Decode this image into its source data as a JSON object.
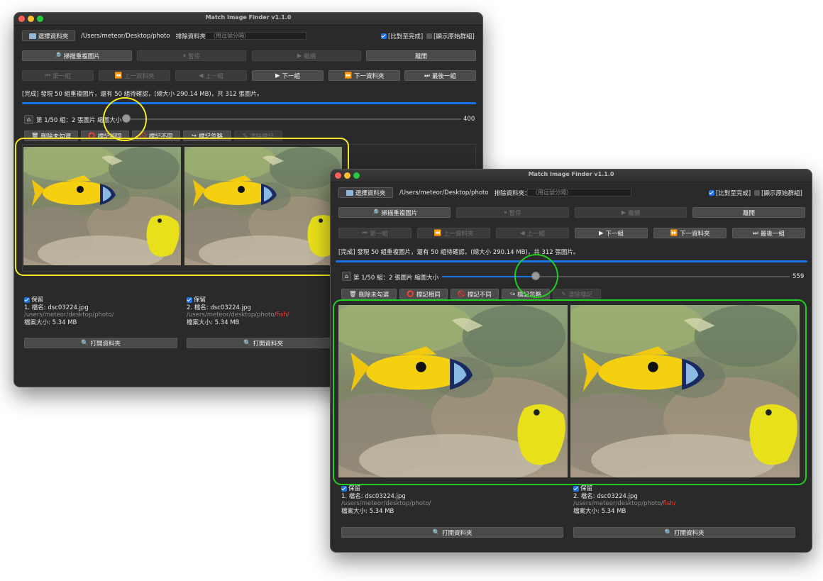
{
  "app": {
    "title": "Match Image Finder v1.1.0"
  },
  "toolbar": {
    "choose_folder": "選擇資料夾",
    "folder_path": "/Users/meteor/Desktop/photo",
    "exclude_label": "排除資料夾：",
    "exclude_placeholder": "（用逗號分隔）",
    "compare_complete": "[比對至完成]",
    "show_raw_groups": "[顯示原始群組]"
  },
  "actions": {
    "scan": "掃描重複圖片",
    "pause": "暫停",
    "resume": "繼續",
    "leave": "離開"
  },
  "nav": {
    "first": "第一組",
    "prev_folder": "上一資料夾",
    "prev": "上一組",
    "next": "下一組",
    "next_folder": "下一資料夾",
    "last": "最後一組"
  },
  "status": {
    "part1": "[完成] 發現 50 組重複圖片，還有 50 組待確認，",
    "part2": "(總大小 290.14 MB)",
    "part3": "，共 312 張圖片。"
  },
  "group": {
    "label": "第 1/50 組：2 張圖片 縮圖大小"
  },
  "windows": {
    "back": {
      "slider_value": "400",
      "slider_fraction": 0.0
    },
    "front": {
      "slider_value": "559",
      "slider_fraction": 0.27
    }
  },
  "marks": {
    "delete_unchecked": "刪除未勾選",
    "mark_same": "標記相同",
    "mark_diff": "標記不同",
    "mark_ignore": "標記忽略",
    "clear_marks": "清除標記"
  },
  "items": [
    {
      "keep": "保留",
      "name": "1. 檔名: dsc03224.jpg",
      "path": "/users/meteor/desktop/photo/",
      "path_red": "",
      "size": "檔案大小: 5.34 MB",
      "open": "打開資料夾"
    },
    {
      "keep": "保留",
      "name": "2. 檔名: dsc03224.jpg",
      "path": "/users/meteor/desktop/photo/",
      "path_red": "fish/",
      "size": "檔案大小: 5.34 MB",
      "open": "打開資料夾"
    }
  ],
  "colors": {
    "accent": "#1a73e8",
    "yellow_highlight": "#f5e71d",
    "green_highlight": "#22cc22",
    "window_bg": "#2a2a2a"
  }
}
